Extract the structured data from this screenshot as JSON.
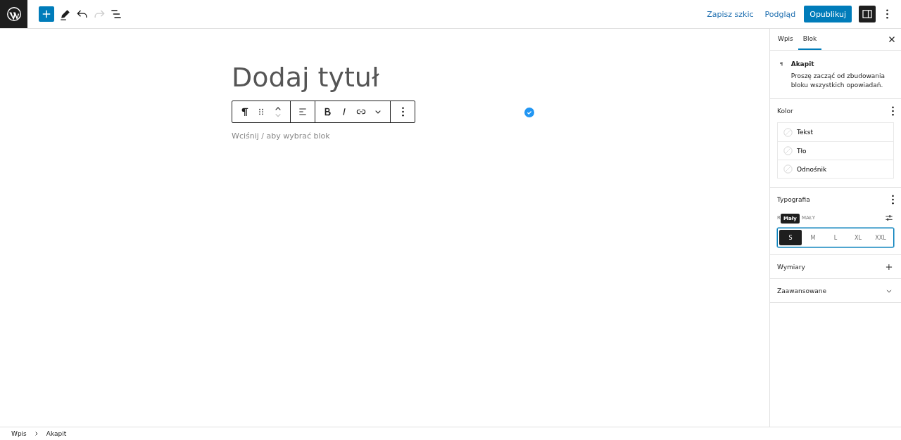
{
  "topbar": {
    "tools": [
      {
        "kind": "add"
      },
      {
        "kind": "edit"
      },
      {
        "kind": "undo",
        "disabled": false
      },
      {
        "kind": "redo",
        "disabled": true
      },
      {
        "kind": "list"
      }
    ],
    "actions": [
      {
        "kind": "link",
        "label": "Zapisz szkic"
      },
      {
        "kind": "link",
        "label": "Podgląd"
      },
      {
        "kind": "primary",
        "label": "Opublikuj"
      }
    ],
    "settings_pressed": true
  },
  "editor": {
    "title_placeholder": "Dodaj tytuł",
    "block_placeholder": "Wciśnij / aby wybrać blok"
  },
  "sidebar": {
    "tabs": [
      {
        "label": "Wpis",
        "selected": false
      },
      {
        "label": "Blok",
        "selected": true
      }
    ],
    "block": {
      "name": "Akapit",
      "description": "Proszę zacząć od zbudowania bloku wszystkich opowiadań."
    },
    "color": {
      "title": "Kolor",
      "items": [
        "Tekst",
        "Tło",
        "Odnośnik"
      ]
    },
    "typography": {
      "title": "Typografia",
      "size_label": "R",
      "size_value": "MAŁY",
      "tooltip": "Mały",
      "sizes": [
        {
          "label": "S",
          "selected": true
        },
        {
          "label": "M",
          "selected": false
        },
        {
          "label": "L",
          "selected": false
        },
        {
          "label": "XL",
          "selected": false
        },
        {
          "label": "XXL",
          "selected": false
        }
      ]
    },
    "panels": [
      {
        "title": "Wymiary",
        "kind": "add"
      },
      {
        "title": "Zaawansowane",
        "kind": "expand"
      }
    ]
  },
  "breadcrumbs": [
    "Wpis",
    "Akapit"
  ]
}
